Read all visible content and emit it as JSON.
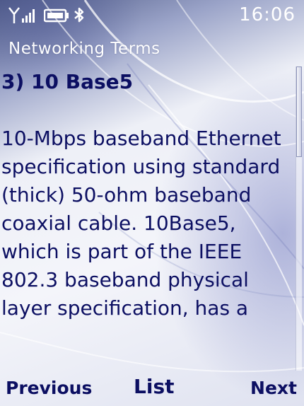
{
  "status_bar": {
    "time": "16:06",
    "icons": [
      "antenna-icon",
      "signal-strength-icon",
      "battery-icon",
      "bluetooth-icon"
    ]
  },
  "app": {
    "title": "Networking Terms"
  },
  "term": {
    "heading": "3) 10 Base5",
    "definition": "10-Mbps baseband Ethernet specification using standard (thick) 50-ohm baseband coaxial cable. 10Base5, which is part of the IEEE 802.3 baseband physical layer specification, has a"
  },
  "softkeys": {
    "left": "Previous",
    "middle": "List",
    "right": "Next"
  },
  "colors": {
    "text": "#0c0f62",
    "header_text": "#ffffff"
  }
}
